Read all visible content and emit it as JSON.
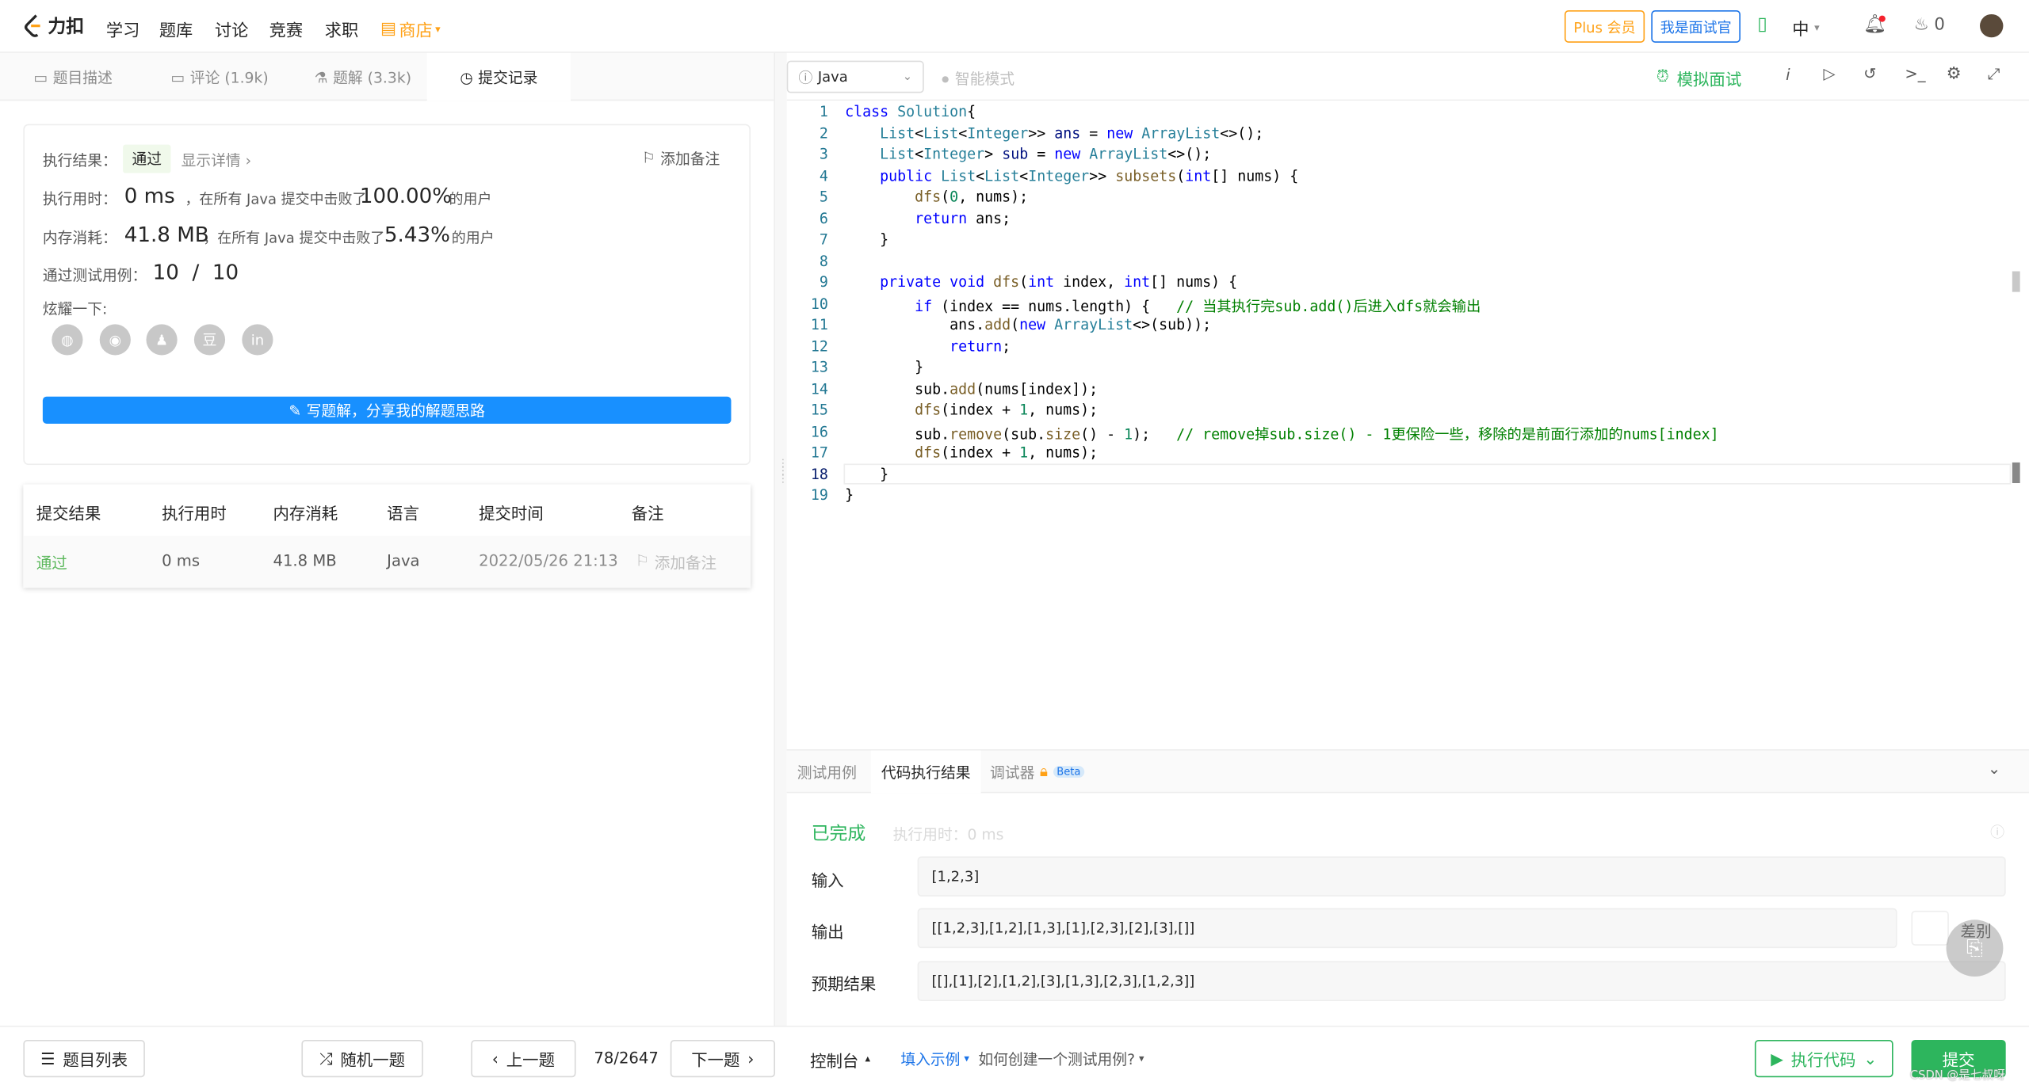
{
  "nav": {
    "logo_text": "力扣",
    "items": [
      "学习",
      "题库",
      "讨论",
      "竞赛",
      "求职"
    ],
    "shop": "商店",
    "plus": "Plus 会员",
    "interviewer": "我是面试官",
    "lang": "中",
    "fire_count": "0"
  },
  "left_tabs": [
    {
      "label": "题目描述",
      "icon": "doc-icon"
    },
    {
      "label": "评论 (1.9k)",
      "icon": "comment-icon"
    },
    {
      "label": "题解 (3.3k)",
      "icon": "flask-icon"
    },
    {
      "label": "提交记录",
      "icon": "clock-icon"
    }
  ],
  "result": {
    "exec_label": "执行结果：",
    "status": "通过",
    "details": "显示详情 ›",
    "add_note": "添加备注",
    "time_label": "执行用时：",
    "time_value": "0 ms",
    "time_mid": "，在所有 Java 提交中击败了",
    "time_pct": "100.00%",
    "time_tail": "的用户",
    "mem_label": "内存消耗：",
    "mem_value": "41.8 MB",
    "mem_mid": "，在所有 Java 提交中击败了",
    "mem_pct": "5.43%",
    "mem_tail": "的用户",
    "cases_label": "通过测试用例：",
    "cases_value": "10  /  10",
    "share_label": "炫耀一下:",
    "share_icons": [
      "wechat-icon",
      "weibo-icon",
      "qq-icon",
      "douban-icon",
      "linkedin-icon"
    ],
    "write_btn": "写题解，分享我的解题思路"
  },
  "sub_table": {
    "headers": [
      "提交结果",
      "执行用时",
      "内存消耗",
      "语言",
      "提交时间",
      "备注"
    ],
    "row": {
      "result": "通过",
      "time": "0 ms",
      "memory": "41.8 MB",
      "lang": "Java",
      "submitted": "2022/05/26 21:13",
      "note": "添加备注"
    }
  },
  "editor": {
    "language": "Java",
    "smart_mode": "智能模式",
    "mock_interview": "模拟面试",
    "cursor_line": 18
  },
  "code_lines": [
    [
      [
        "kw",
        "class "
      ],
      [
        "ty",
        "Solution"
      ],
      [
        "",
        "{"
      ]
    ],
    [
      [
        "",
        "    "
      ],
      [
        "ty",
        "List"
      ],
      [
        "",
        "<"
      ],
      [
        "ty",
        "List"
      ],
      [
        "",
        "<"
      ],
      [
        "ty",
        "Integer"
      ],
      [
        "",
        ">> "
      ],
      [
        "vr",
        "ans"
      ],
      [
        "",
        " = "
      ],
      [
        "kw",
        "new "
      ],
      [
        "ty",
        "ArrayList"
      ],
      [
        "",
        "<>();"
      ]
    ],
    [
      [
        "",
        "    "
      ],
      [
        "ty",
        "List"
      ],
      [
        "",
        "<"
      ],
      [
        "ty",
        "Integer"
      ],
      [
        "",
        "> "
      ],
      [
        "vr",
        "sub"
      ],
      [
        "",
        " = "
      ],
      [
        "kw",
        "new "
      ],
      [
        "ty",
        "ArrayList"
      ],
      [
        "",
        "<>();"
      ]
    ],
    [
      [
        "",
        "    "
      ],
      [
        "kw",
        "public "
      ],
      [
        "ty",
        "List"
      ],
      [
        "",
        "<"
      ],
      [
        "ty",
        "List"
      ],
      [
        "",
        "<"
      ],
      [
        "ty",
        "Integer"
      ],
      [
        "",
        ">> "
      ],
      [
        "fn",
        "subsets"
      ],
      [
        "",
        "("
      ],
      [
        "kw",
        "int"
      ],
      [
        "",
        "[] nums) {"
      ]
    ],
    [
      [
        "",
        "        "
      ],
      [
        "fn",
        "dfs"
      ],
      [
        "",
        "("
      ],
      [
        "nm",
        "0"
      ],
      [
        "",
        ", nums);"
      ]
    ],
    [
      [
        "",
        "        "
      ],
      [
        "kw",
        "return "
      ],
      [
        "",
        "ans;"
      ]
    ],
    [
      [
        "",
        "    }"
      ]
    ],
    [
      [
        "",
        ""
      ]
    ],
    [
      [
        "",
        "    "
      ],
      [
        "kw",
        "private void "
      ],
      [
        "fn",
        "dfs"
      ],
      [
        "",
        "("
      ],
      [
        "kw",
        "int "
      ],
      [
        "",
        "index, "
      ],
      [
        "kw",
        "int"
      ],
      [
        "",
        "[] nums) {"
      ]
    ],
    [
      [
        "",
        "        "
      ],
      [
        "kw",
        "if "
      ],
      [
        "",
        "(index == nums.length) {   "
      ],
      [
        "cm",
        "// 当其执行完sub.add()后进入dfs就会输出"
      ]
    ],
    [
      [
        "",
        "            ans."
      ],
      [
        "fn",
        "add"
      ],
      [
        "",
        "("
      ],
      [
        "kw",
        "new "
      ],
      [
        "ty",
        "ArrayList"
      ],
      [
        "",
        "<>(sub));"
      ]
    ],
    [
      [
        "",
        "            "
      ],
      [
        "kw",
        "return"
      ],
      [
        "",
        ";"
      ]
    ],
    [
      [
        "",
        "        }"
      ]
    ],
    [
      [
        "",
        "        sub."
      ],
      [
        "fn",
        "add"
      ],
      [
        "",
        "(nums[index]);"
      ]
    ],
    [
      [
        "",
        "        "
      ],
      [
        "fn",
        "dfs"
      ],
      [
        "",
        "(index + "
      ],
      [
        "nm",
        "1"
      ],
      [
        "",
        ", nums);"
      ]
    ],
    [
      [
        "",
        "        sub."
      ],
      [
        "fn",
        "remove"
      ],
      [
        "",
        "(sub."
      ],
      [
        "fn",
        "size"
      ],
      [
        "",
        "() - "
      ],
      [
        "nm",
        "1"
      ],
      [
        "",
        ");   "
      ],
      [
        "cm",
        "// remove掉sub.size() - 1更保险一些，移除的是前面行添加的nums[index]"
      ]
    ],
    [
      [
        "",
        "        "
      ],
      [
        "fn",
        "dfs"
      ],
      [
        "",
        "(index + "
      ],
      [
        "nm",
        "1"
      ],
      [
        "",
        ", nums);"
      ]
    ],
    [
      [
        "",
        "    }"
      ]
    ],
    [
      [
        "",
        "}"
      ]
    ]
  ],
  "result_panel": {
    "tabs": [
      "测试用例",
      "代码执行结果",
      "调试器"
    ],
    "beta": "Beta",
    "status": "已完成",
    "exec_time": "执行用时：0 ms",
    "input_label": "输入",
    "input_value": "[1,2,3]",
    "output_label": "输出",
    "output_value": "[[1,2,3],[1,2],[1,3],[1],[2,3],[2],[3],[]]",
    "diff": "差别",
    "expected_label": "预期结果",
    "expected_value": "[[],[1],[2],[1,2],[3],[1,3],[2,3],[1,2,3]]"
  },
  "bottom": {
    "problem_list": "题目列表",
    "random": "随机一题",
    "prev": "上一题",
    "counter": "78/2647",
    "next": "下一题",
    "console": "控制台",
    "fill_example": "填入示例",
    "how_to": "如何创建一个测试用例?",
    "run": "执行代码",
    "submit": "提交",
    "watermark": "CSDN @是七叔呀"
  },
  "colors": {
    "accent": "#1890ff",
    "success": "#2db55d",
    "pass": "#5cb85c"
  }
}
